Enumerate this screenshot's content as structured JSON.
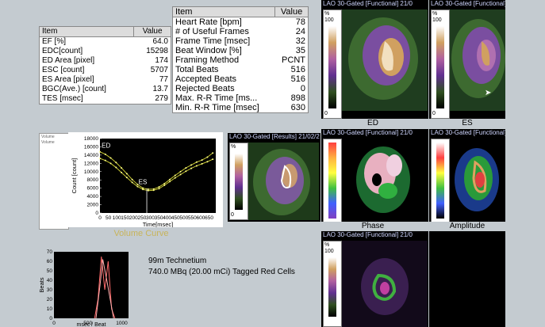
{
  "small_table": {
    "header": {
      "item": "Item",
      "value": "Value"
    },
    "rows": [
      {
        "item": "EF [%]",
        "value": "64.0"
      },
      {
        "item": "EDC[count]",
        "value": "15298"
      },
      {
        "item": "ED Area [pixel]",
        "value": "174"
      },
      {
        "item": "ESC [count]",
        "value": "5707"
      },
      {
        "item": "ES Area [pixel]",
        "value": "77"
      },
      {
        "item": "BGC(Ave.) [count]",
        "value": "13.7"
      },
      {
        "item": "TES [msec]",
        "value": "279"
      }
    ]
  },
  "big_table": {
    "header": {
      "item": "Item",
      "value": "Value"
    },
    "rows": [
      {
        "item": "Heart Rate [bpm]",
        "value": "78"
      },
      {
        "item": "# of Useful Frames",
        "value": "24"
      },
      {
        "item": "Frame Time [msec]",
        "value": "32"
      },
      {
        "item": "Beat Window [%]",
        "value": "35"
      },
      {
        "item": "Framing Method",
        "value": "PCNT"
      },
      {
        "item": "Total Beats",
        "value": "516"
      },
      {
        "item": "Accepted Beats",
        "value": "516"
      },
      {
        "item": "Rejected Beats",
        "value": "0"
      },
      {
        "item": "Max. R-R Time [ms...",
        "value": "898"
      },
      {
        "item": "Min. R-R Time [msec]",
        "value": "630"
      }
    ]
  },
  "legend_box": {
    "items": [
      "Volume",
      "Volume"
    ]
  },
  "volume_chart": {
    "caption": "Volume Curve",
    "ylabel": "Count [count]",
    "xlabel": "Time[msec]",
    "ed_label": "ED",
    "es_label": "ES",
    "yticks": [
      "0",
      "2000",
      "4000",
      "6000",
      "8000",
      "10000",
      "12000",
      "14000",
      "16000",
      "18000"
    ],
    "xticks": [
      "0",
      "50",
      "100",
      "150",
      "200",
      "250",
      "300",
      "350",
      "400",
      "450",
      "500",
      "550",
      "600",
      "650"
    ]
  },
  "histogram": {
    "ylabel": "Beats",
    "xlabel": "msec / Beat",
    "yticks": [
      "0",
      "10",
      "20",
      "30",
      "40",
      "50",
      "60",
      "70"
    ],
    "xticks": [
      "0",
      "500",
      "1000"
    ]
  },
  "info": {
    "line1": "99m Technetium",
    "line2": "740.0 MBq (20.00 mCi) Tagged Red Cells"
  },
  "panels": {
    "lao_results_title": "LAO 30-Gated [Results] 21/02/2",
    "lao_func_title": "LAO 30-Gated [Functional] 21/0",
    "lao_func_title_cut": "LAO 30-Gated [Functional] 21/0",
    "lut_unit": "%",
    "lut_max": "100",
    "lut_min": "0",
    "ed_label": "ED",
    "es_label": "ES",
    "phase_label": "Phase",
    "amplitude_label": "Amplitude"
  },
  "colors": {
    "background": "#c4cbd0",
    "curve_line": "#c8c832",
    "curve_points": "#ffff88",
    "caption": "#c8b45a"
  },
  "chart_data": [
    {
      "type": "line",
      "xlabel": "Time[msec]",
      "ylabel": "Count [count]",
      "xlim": [
        0,
        690
      ],
      "ylim": [
        0,
        18000
      ],
      "series": [
        {
          "x": [
            0,
            32,
            64,
            96,
            128,
            160,
            192,
            224,
            256,
            288,
            320,
            352,
            384,
            416,
            448,
            480,
            512,
            544,
            576,
            608,
            640,
            672
          ],
          "values": [
            14800,
            14200,
            13300,
            12200,
            10900,
            9500,
            8100,
            6900,
            6000,
            5750,
            5800,
            6300,
            7100,
            8100,
            9100,
            10000,
            10900,
            11600,
            12300,
            12800,
            13500,
            14500
          ]
        },
        {
          "x": [
            0,
            32,
            64,
            96,
            128,
            160,
            192,
            224,
            256,
            288,
            320,
            352,
            384,
            416,
            448,
            480,
            512,
            544,
            576,
            608,
            640,
            672
          ],
          "values": [
            13200,
            12700,
            12000,
            11000,
            9800,
            8600,
            7400,
            6400,
            5700,
            5400,
            5500,
            5900,
            6700,
            7600,
            8500,
            9300,
            10100,
            10800,
            11400,
            11900,
            12400,
            13000
          ]
        }
      ]
    },
    {
      "type": "line",
      "xlabel": "msec / Beat",
      "ylabel": "Beats",
      "xlim": [
        0,
        1100
      ],
      "ylim": [
        0,
        70
      ],
      "series": [
        {
          "x": [
            600,
            650,
            700,
            750,
            800,
            850,
            900
          ],
          "values": [
            0,
            20,
            65,
            30,
            60,
            10,
            0
          ]
        },
        {
          "x": [
            620,
            680,
            720,
            780,
            830,
            880
          ],
          "values": [
            0,
            35,
            62,
            40,
            20,
            0
          ]
        }
      ]
    }
  ]
}
